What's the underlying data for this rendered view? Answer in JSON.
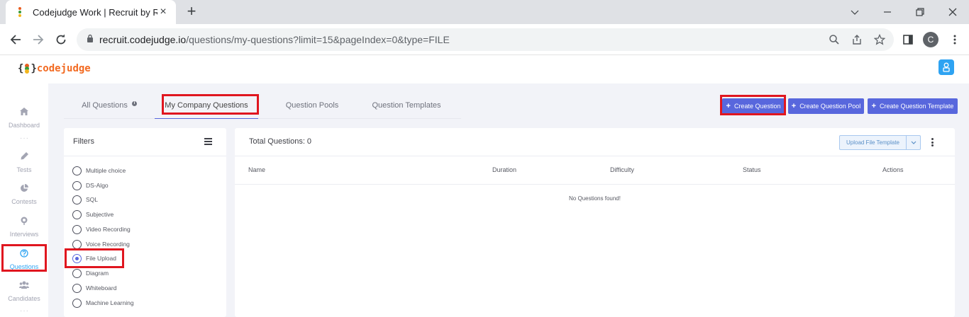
{
  "browser": {
    "tab_title": "Codejudge Work | Recruit by Real",
    "url_domain": "recruit.codejudge.io",
    "url_path": "/questions/my-questions?limit=15&pageIndex=0&type=FILE",
    "profile_initial": "C"
  },
  "app": {
    "logo_left": "{",
    "logo_right": "}",
    "logo_text": "codejudge"
  },
  "sidebar": {
    "items": [
      {
        "label": "Dashboard",
        "icon": "home-icon"
      },
      {
        "label": "Tests",
        "icon": "pencil-icon"
      },
      {
        "label": "Contests",
        "icon": "pie-chart-icon"
      },
      {
        "label": "Interviews",
        "icon": "interview-icon"
      },
      {
        "label": "Questions",
        "icon": "question-icon",
        "active": true
      },
      {
        "label": "Candidates",
        "icon": "users-icon"
      }
    ],
    "separator": "···"
  },
  "tabs": [
    {
      "label": "All Questions"
    },
    {
      "label": "My Company Questions",
      "active": true
    },
    {
      "label": "Question Pools"
    },
    {
      "label": "Question Templates"
    }
  ],
  "actions": {
    "create_question": "Create Question",
    "create_pool": "Create Question Pool",
    "create_template": "Create Question Template"
  },
  "filters": {
    "title": "Filters",
    "options": [
      {
        "label": "Multiple choice",
        "checked": false
      },
      {
        "label": "DS-Algo",
        "checked": false
      },
      {
        "label": "SQL",
        "checked": false
      },
      {
        "label": "Subjective",
        "checked": false
      },
      {
        "label": "Video Recording",
        "checked": false
      },
      {
        "label": "Voice Recording",
        "checked": false
      },
      {
        "label": "File Upload",
        "checked": true
      },
      {
        "label": "Diagram",
        "checked": false
      },
      {
        "label": "Whiteboard",
        "checked": false
      },
      {
        "label": "Machine Learning",
        "checked": false
      }
    ]
  },
  "list": {
    "total_label": "Total Questions: 0",
    "upload_btn": "Upload File Template",
    "columns": {
      "name": "Name",
      "duration": "Duration",
      "difficulty": "Difficulty",
      "status": "Status",
      "actions": "Actions"
    },
    "empty": "No Questions found!"
  },
  "colors": {
    "accent": "#5867dd",
    "highlight": "#e0161f",
    "logo_orange": "#f26a21",
    "active_blue": "#2ea3f2"
  }
}
